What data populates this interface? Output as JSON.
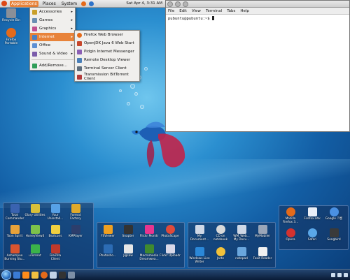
{
  "panel": {
    "menus": [
      "Applications",
      "Places",
      "System"
    ],
    "clock": "Sat Apr 4, 3:31 AM"
  },
  "desktop_icons": [
    {
      "label": "Recycle Bin",
      "icon": "recycle-bin-icon",
      "color": "#8a8f98"
    },
    {
      "label": "Firefox Portable",
      "icon": "firefox-icon",
      "color": "#e46a1a"
    }
  ],
  "apps_menu": [
    {
      "label": "Accessories",
      "icon": "accessories-icon",
      "color": "#c9a02b",
      "submenu": true
    },
    {
      "label": "Games",
      "icon": "games-icon",
      "color": "#6a8fb3",
      "submenu": true
    },
    {
      "label": "Graphics",
      "icon": "graphics-icon",
      "color": "#c05090",
      "submenu": true
    },
    {
      "label": "Internet",
      "icon": "internet-icon",
      "color": "#4d7fbf",
      "submenu": true,
      "selected": true
    },
    {
      "label": "Office",
      "icon": "office-icon",
      "color": "#5c8fd3",
      "submenu": true
    },
    {
      "label": "Sound & Video",
      "icon": "sound-video-icon",
      "color": "#7b5caa",
      "submenu": true
    },
    {
      "label": "Add/Remove...",
      "icon": "add-remove-icon",
      "color": "#2f9e58",
      "submenu": false
    }
  ],
  "internet_menu": [
    {
      "label": "Firefox Web Browser",
      "icon": "firefox-icon",
      "color": "#e46a1a"
    },
    {
      "label": "OpenJDK Java 6 Web Start",
      "icon": "java-icon",
      "color": "#c7462b"
    },
    {
      "label": "Pidgin Internet Messenger",
      "icon": "pidgin-icon",
      "color": "#8b5fb5"
    },
    {
      "label": "Remote Desktop Viewer",
      "icon": "remote-desktop-icon",
      "color": "#4a7fb8"
    },
    {
      "label": "Terminal Server Client",
      "icon": "terminal-server-icon",
      "color": "#5e6d7c"
    },
    {
      "label": "Transmission BitTorrent Client",
      "icon": "transmission-icon",
      "color": "#b23b3b"
    }
  ],
  "terminal": {
    "title": "",
    "menus": [
      "File",
      "Edit",
      "View",
      "Terminal",
      "Tabs",
      "Help"
    ],
    "prompt": "pubuntu@pubuntu:~$ "
  },
  "gadget_left": [
    {
      "label": "Total Commander",
      "icon": "total-commander-icon",
      "color": "#3a63b0"
    },
    {
      "label": "Glary Utilities",
      "icon": "glary-icon",
      "color": "#d8c03a"
    },
    {
      "label": "Your Uninstall...",
      "icon": "uninstaller-icon",
      "color": "#57a1e6"
    },
    {
      "label": "Format Factory",
      "icon": "format-factory-icon",
      "color": "#e0aa2b"
    },
    {
      "label": "Toon Spirit",
      "icon": "toon-spirit-icon",
      "color": "#e8a23a"
    },
    {
      "label": "HoneyView3",
      "icon": "honeyview-icon",
      "color": "#7dc24b"
    },
    {
      "label": "BezIcons",
      "icon": "bezicons-icon",
      "color": "#f0d040"
    },
    {
      "label": "KMPlayer",
      "icon": "kmplayer-icon",
      "color": "#2c3e6c"
    },
    {
      "label": "Ashampoo Burning Stu...",
      "icon": "ashampoo-icon",
      "color": "#d9542e"
    },
    {
      "label": "uTorrent",
      "icon": "utorrent-icon",
      "color": "#3bb34a"
    },
    {
      "label": "FileZilla Client",
      "icon": "filezilla-icon",
      "color": "#c0392b"
    }
  ],
  "gadget_mid": [
    {
      "label": "FSViewer",
      "icon": "fsviewer-icon",
      "color": "#f0a020"
    },
    {
      "label": "Snapter",
      "icon": "snapter-icon",
      "color": "#333333"
    },
    {
      "label": "Flickr Monitr",
      "icon": "flickr-monitr-icon",
      "color": "#e8358f"
    },
    {
      "label": "PhotoScape",
      "icon": "photoscape-icon",
      "color": "#e04a3a"
    },
    {
      "label": "Photosho...",
      "icon": "photoshop-icon",
      "color": "#2c6cb4"
    },
    {
      "label": "Jigsaw",
      "icon": "jigsaw-icon",
      "color": "#e6e6e6"
    },
    {
      "label": "Macromedia Dreamwea...",
      "icon": "dreamweaver-icon",
      "color": "#3f8a2f"
    },
    {
      "label": "Flickr Uploadr",
      "icon": "flickr-uploadr-icon",
      "color": "#d8d8e8"
    }
  ],
  "gadget_right_mid": [
    {
      "label": "My Document...",
      "icon": "my-documents-icon",
      "color": "#cfd8e6"
    },
    {
      "label": "CD on notebook",
      "icon": "cd-icon",
      "color": "#d9d9d9"
    },
    {
      "label": "WM_Web... My Docu...",
      "icon": "wm-web-icon",
      "color": "#cfd8e6"
    },
    {
      "label": "MyMobiler",
      "icon": "mymobiler-icon",
      "color": "#9aa6b8"
    },
    {
      "label": "Windows Live Writer",
      "icon": "live-writer-icon",
      "color": "#2b88d8"
    },
    {
      "label": "Jarte",
      "icon": "jarte-icon",
      "color": "#f3c23a"
    },
    {
      "label": "notepad",
      "icon": "notepad-icon",
      "color": "#6aa6dd"
    },
    {
      "label": "Foxit Reader",
      "icon": "foxit-icon",
      "color": "#f1f1f1"
    }
  ],
  "gadget_right": [
    {
      "label": "Mozilla Firefox 3...",
      "icon": "firefox-icon",
      "color": "#e46a1a"
    },
    {
      "label": "Firefox.ahk",
      "icon": "ahk-icon",
      "color": "#e9eef7"
    },
    {
      "label": "Google 크롬",
      "icon": "chrome-icon",
      "color": "#4a90e2"
    },
    {
      "label": "Opera",
      "icon": "opera-icon",
      "color": "#d3322f"
    },
    {
      "label": "Safari",
      "icon": "safari-icon",
      "color": "#5aa7e8"
    },
    {
      "label": "Songbird",
      "icon": "songbird-icon",
      "color": "#3a3a3a"
    }
  ],
  "taskbar": {
    "pinned": [
      {
        "icon": "ie-icon",
        "color": "#3a7bd5"
      },
      {
        "icon": "media-player-icon",
        "color": "#ff8c1a"
      },
      {
        "icon": "folder-icon",
        "color": "#f0c040"
      },
      {
        "icon": "firefox-icon",
        "color": "#e46a1a"
      },
      {
        "icon": "window-icon",
        "color": "#c2d3e8"
      },
      {
        "icon": "terminal-icon",
        "color": "#333333"
      },
      {
        "icon": "app-icon",
        "color": "#7d8fa6"
      }
    ]
  }
}
